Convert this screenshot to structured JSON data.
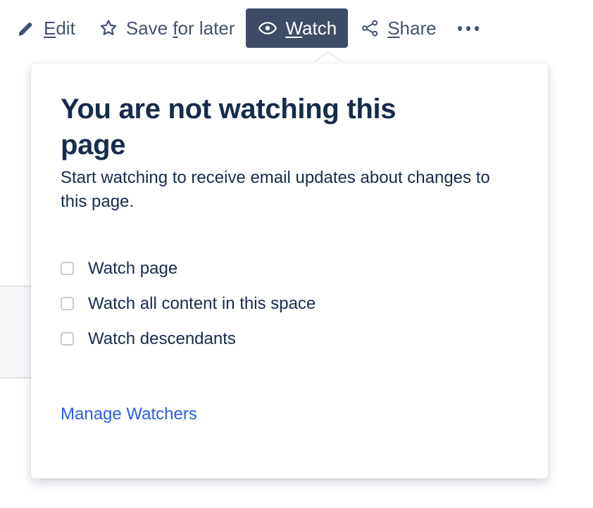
{
  "colors": {
    "active_button_bg": "#3e4c66",
    "toolbar_text": "#42526e",
    "heading_text": "#172b4d",
    "link_blue": "#2a5fd9",
    "checkbox_border": "#c6cbd4",
    "popup_bg": "#ffffff",
    "table_row_bg": "#f7f8fa",
    "table_border": "#dfe1e6"
  },
  "toolbar": {
    "items": [
      {
        "id": "edit",
        "label": "Edit",
        "accesskey": "E",
        "icon": "pencil-icon",
        "active": false
      },
      {
        "id": "save-for-later",
        "label": "Save for later",
        "accesskey": "f",
        "icon": "star-icon",
        "active": false
      },
      {
        "id": "watch",
        "label": "Watch",
        "accesskey": "W",
        "icon": "eye-icon",
        "active": true
      },
      {
        "id": "share",
        "label": "Share",
        "accesskey": "S",
        "icon": "share-icon",
        "active": false
      },
      {
        "id": "more",
        "label": "",
        "accesskey": "",
        "icon": "ellipsis-icon",
        "active": false
      }
    ]
  },
  "popup": {
    "title": "You are not watching this page",
    "description": "Start watching to receive email updates about changes to this page.",
    "options": [
      {
        "id": "watch-page",
        "label": "Watch page",
        "checked": false
      },
      {
        "id": "watch-space-content",
        "label": "Watch all content in this space",
        "checked": false
      },
      {
        "id": "watch-descendants",
        "label": "Watch descendants",
        "checked": false
      }
    ],
    "manage_watchers_label": "Manage Watchers"
  }
}
